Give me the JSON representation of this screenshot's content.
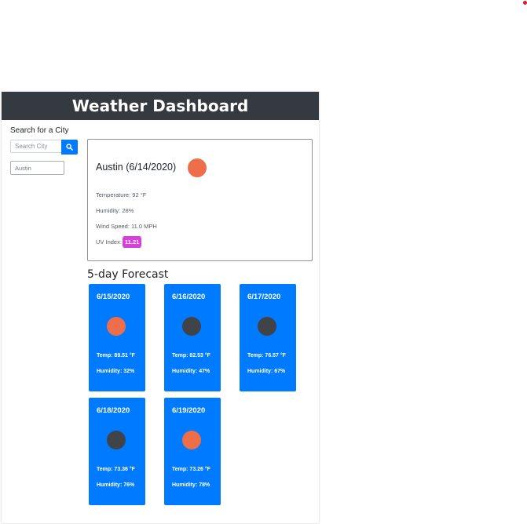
{
  "header": {
    "title": "Weather Dashboard"
  },
  "search": {
    "title": "Search for a City",
    "placeholder": "Search City",
    "button_icon": "search-icon",
    "history": [
      "Austin"
    ]
  },
  "current": {
    "title": "Austin (6/14/2020)",
    "icon": "sun-icon",
    "icon_color": "#ee6e4a",
    "temperature": "Temperature: 92 °F",
    "humidity": "Humidity: 28%",
    "wind": "Wind Speed: 11.0 MPH",
    "uv_label": "UV Index:",
    "uv_value": "11.21",
    "uv_color": "#d63fda"
  },
  "forecast": {
    "title": "5-day Forecast",
    "days": [
      {
        "date": "6/15/2020",
        "icon": "sun-icon",
        "icon_color": "#ee6e4a",
        "temp": "Temp: 89.51 °F",
        "humidity": "Humidity: 32%"
      },
      {
        "date": "6/16/2020",
        "icon": "cloud-icon",
        "icon_color": "#404448",
        "temp": "Temp: 82.53 °F",
        "humidity": "Humidity: 47%"
      },
      {
        "date": "6/17/2020",
        "icon": "cloud-icon",
        "icon_color": "#404448",
        "temp": "Temp: 76.57 °F",
        "humidity": "Humidity: 67%"
      },
      {
        "date": "6/18/2020",
        "icon": "cloud-icon",
        "icon_color": "#404448",
        "temp": "Temp: 73.36 °F",
        "humidity": "Humidity: 76%"
      },
      {
        "date": "6/19/2020",
        "icon": "sun-icon",
        "icon_color": "#ee6e4a",
        "temp": "Temp: 73.26 °F",
        "humidity": "Humidity: 78%"
      }
    ]
  },
  "colors": {
    "header_bg": "#343a40",
    "accent": "#007bff"
  }
}
